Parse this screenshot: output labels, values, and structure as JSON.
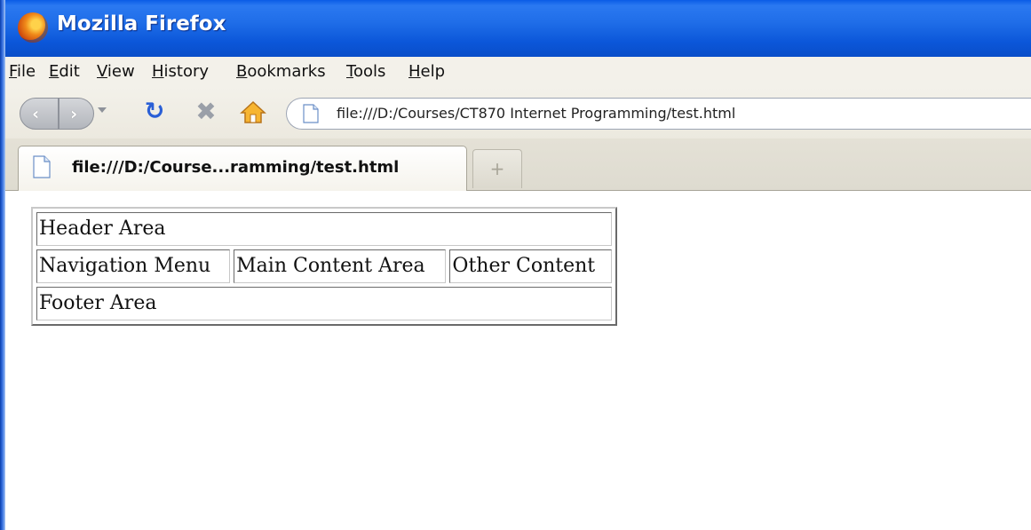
{
  "window": {
    "title": "Mozilla Firefox"
  },
  "menu": {
    "items": [
      "File",
      "Edit",
      "View",
      "History",
      "Bookmarks",
      "Tools",
      "Help"
    ]
  },
  "navigation": {
    "url": "file:///D:/Courses/CT870 Internet Programming/test.html",
    "back_icon": "chevron-left-icon",
    "forward_icon": "chevron-right-icon",
    "reload_icon": "reload-icon",
    "stop_icon": "stop-icon",
    "home_icon": "home-icon"
  },
  "tabs": {
    "active_label": "file:///D:/Course...ramming/test.html",
    "new_tab_symbol": "+"
  },
  "page": {
    "header": "Header Area",
    "nav_menu": "Navigation Menu",
    "main_content": "Main Content Area",
    "other_content": "Other Content",
    "footer": "Footer Area"
  },
  "colors": {
    "titlebar": "#0a56d9",
    "chrome": "#ece9df",
    "reload": "#2a5fd6",
    "home": "#f0a020"
  }
}
